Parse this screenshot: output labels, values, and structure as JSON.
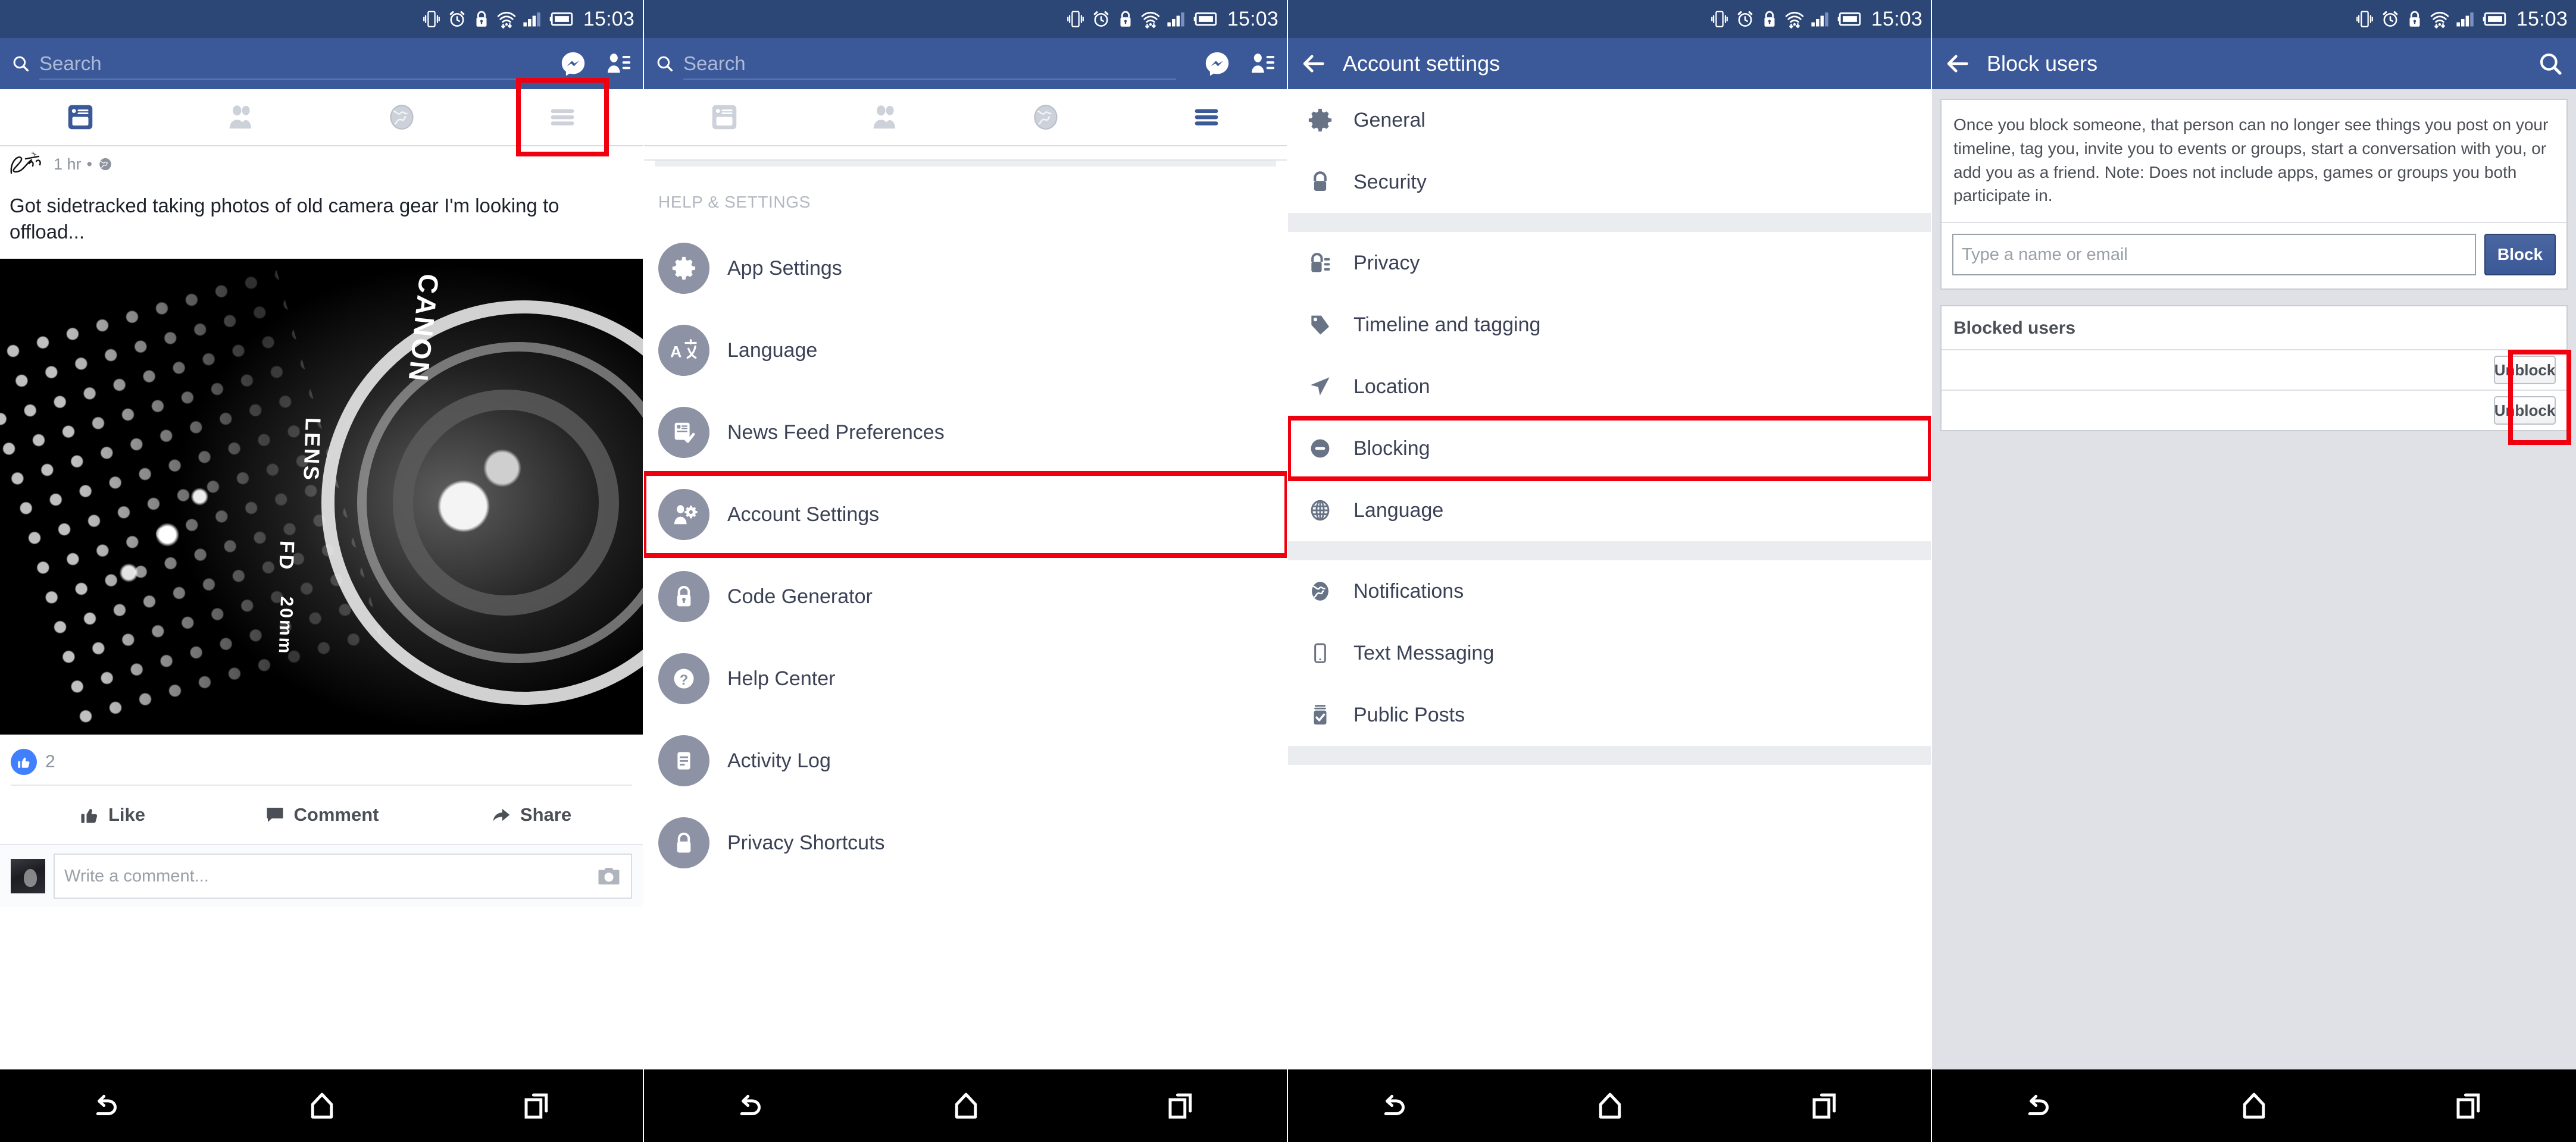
{
  "status_bar": {
    "time": "15:03",
    "icons": [
      "vibrate-icon",
      "alarm-icon",
      "lock-icon",
      "wifi-icon",
      "signal-icon",
      "battery-icon"
    ]
  },
  "colors": {
    "status_bar": "#2c4676",
    "header_blue": "#3b5998",
    "highlight_red": "#f0000f",
    "icon_gray": "#8d93a4",
    "text_dark": "#3b4256",
    "page_bg": "#dfe1e6"
  },
  "panel1": {
    "name": "news-feed",
    "search": {
      "placeholder": "Search"
    },
    "header_icons": [
      "messenger-icon",
      "friend-requests-icon"
    ],
    "tabs": [
      {
        "name": "news-feed-tab",
        "icon": "news-feed-icon",
        "active": true,
        "highlighted": false
      },
      {
        "name": "friends-tab",
        "icon": "friends-icon",
        "active": false,
        "highlighted": false
      },
      {
        "name": "notifications-tab",
        "icon": "globe-icon",
        "active": false,
        "highlighted": false
      },
      {
        "name": "more-menu-tab",
        "icon": "hamburger-icon",
        "active": false,
        "highlighted": true
      }
    ],
    "post": {
      "author_signature": "Scott",
      "time": "1 hr",
      "privacy_icon": "globe-icon",
      "text": "Got sidetracked taking photos of old camera gear I'm looking to offload...",
      "photo_alt": "canon-lens-photo",
      "photo_labels": [
        "CANON",
        "LENS",
        "FD",
        "20mm"
      ],
      "likes_count": "2",
      "actions": [
        {
          "label": "Like",
          "icon": "thumbs-up-icon"
        },
        {
          "label": "Comment",
          "icon": "comment-bubble-icon"
        },
        {
          "label": "Share",
          "icon": "share-arrow-icon"
        }
      ],
      "comment_placeholder": "Write a comment...",
      "comment_camera_icon": "camera-icon"
    }
  },
  "panel2": {
    "name": "more-menu",
    "search": {
      "placeholder": "Search"
    },
    "section_label": "HELP & SETTINGS",
    "items": [
      {
        "label": "App Settings",
        "icon": "gear-icon",
        "highlighted": false
      },
      {
        "label": "Language",
        "icon": "translate-icon",
        "highlighted": false
      },
      {
        "label": "News Feed Preferences",
        "icon": "newsfeed-prefs-icon",
        "highlighted": false
      },
      {
        "label": "Account Settings",
        "icon": "account-settings-icon",
        "highlighted": true
      },
      {
        "label": "Code Generator",
        "icon": "lock-icon",
        "highlighted": false
      },
      {
        "label": "Help Center",
        "icon": "question-mark-icon",
        "highlighted": false
      },
      {
        "label": "Activity Log",
        "icon": "activity-log-icon",
        "highlighted": false
      },
      {
        "label": "Privacy Shortcuts",
        "icon": "padlock-icon",
        "highlighted": false
      }
    ]
  },
  "panel3": {
    "name": "account-settings",
    "title": "Account settings",
    "back_icon": "back-arrow-icon",
    "groups": [
      {
        "items": [
          {
            "label": "General",
            "icon": "gear-icon",
            "highlighted": false
          },
          {
            "label": "Security",
            "icon": "padlock-icon",
            "highlighted": false
          }
        ]
      },
      {
        "items": [
          {
            "label": "Privacy",
            "icon": "privacy-lock-icon",
            "highlighted": false
          },
          {
            "label": "Timeline and tagging",
            "icon": "tag-icon",
            "highlighted": false
          },
          {
            "label": "Location",
            "icon": "location-arrow-icon",
            "highlighted": false
          },
          {
            "label": "Blocking",
            "icon": "block-icon",
            "highlighted": true
          },
          {
            "label": "Language",
            "icon": "globe-grid-icon",
            "highlighted": false
          }
        ]
      },
      {
        "items": [
          {
            "label": "Notifications",
            "icon": "globe-icon",
            "highlighted": false
          },
          {
            "label": "Text Messaging",
            "icon": "phone-icon",
            "highlighted": false
          },
          {
            "label": "Public Posts",
            "icon": "public-posts-icon",
            "highlighted": false
          }
        ]
      }
    ]
  },
  "panel4": {
    "name": "block-users",
    "title": "Block users",
    "back_icon": "back-arrow-icon",
    "search_icon": "search-icon",
    "description": "Once you block someone, that person can no longer see things you post on your timeline, tag you, invite you to events or groups, start a conversation with you, or add you as a friend. Note: Does not include apps, games or groups you both participate in.",
    "block_input_placeholder": "Type a name or email",
    "block_button_label": "Block",
    "blocked_users_title": "Blocked users",
    "blocked_rows": [
      {
        "name": "",
        "action_label": "Unblock"
      },
      {
        "name": "",
        "action_label": "Unblock"
      }
    ]
  },
  "navbar": {
    "buttons": [
      {
        "name": "back-button",
        "icon": "back-icon"
      },
      {
        "name": "home-button",
        "icon": "home-icon"
      },
      {
        "name": "recents-button",
        "icon": "recents-icon"
      }
    ]
  }
}
